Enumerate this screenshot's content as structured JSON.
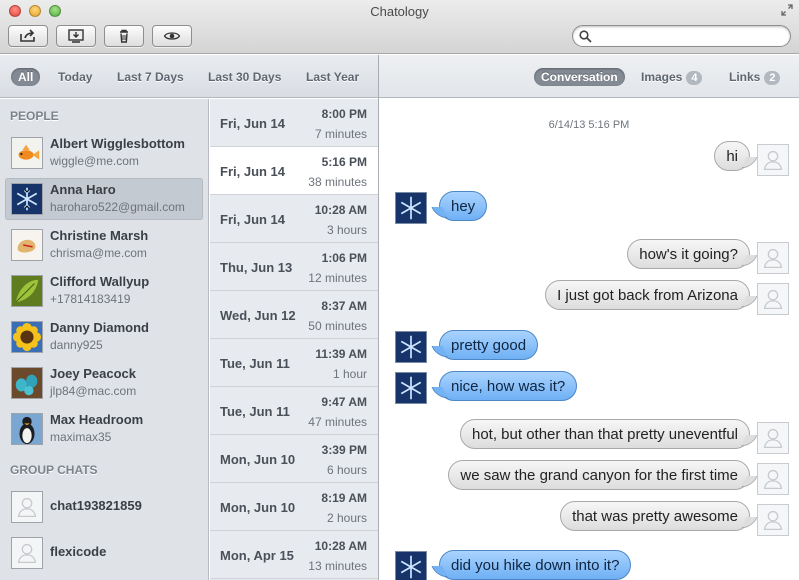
{
  "window": {
    "title": "Chatology"
  },
  "toolbar": {
    "buttons": [
      {
        "name": "share",
        "icon": "share-icon"
      },
      {
        "name": "export",
        "icon": "export-icon"
      },
      {
        "name": "delete",
        "icon": "trash-icon"
      },
      {
        "name": "preview",
        "icon": "eye-icon"
      }
    ],
    "search": {
      "value": "",
      "placeholder": "",
      "icon": "search-icon"
    }
  },
  "filters": [
    {
      "label": "All",
      "active": true
    },
    {
      "label": "Today"
    },
    {
      "label": "Last 7 Days"
    },
    {
      "label": "Last 30 Days"
    },
    {
      "label": "Last Year"
    }
  ],
  "view_tabs": [
    {
      "label": "Conversation",
      "active": true
    },
    {
      "label": "Images",
      "count": "4"
    },
    {
      "label": "Links",
      "count": "2"
    }
  ],
  "sidebar": {
    "people_header": "PEOPLE",
    "people": [
      {
        "name": "Albert Wigglesbottom",
        "sub": "wiggle@me.com",
        "avatar": "goldfish-avatar"
      },
      {
        "name": "Anna Haro",
        "sub": "haroharo522@gmail.com",
        "avatar": "snowflake-avatar",
        "selected": true
      },
      {
        "name": "Christine Marsh",
        "sub": "chrisma@me.com",
        "avatar": "fortune-cookie-avatar"
      },
      {
        "name": "Clifford Wallyup",
        "sub": "+17814183419",
        "avatar": "leaf-avatar"
      },
      {
        "name": "Danny Diamond",
        "sub": "danny925",
        "avatar": "sunflower-avatar"
      },
      {
        "name": "Joey Peacock",
        "sub": "jlp84@mac.com",
        "avatar": "eggs-avatar"
      },
      {
        "name": "Max Headroom",
        "sub": "maximax35",
        "avatar": "penguin-avatar"
      }
    ],
    "groups_header": "GROUP CHATS",
    "groups": [
      {
        "name": "chat193821859",
        "avatar": "person-silhouette-avatar"
      },
      {
        "name": "flexicode",
        "avatar": "person-silhouette-avatar"
      }
    ]
  },
  "conversations": [
    {
      "date": "Fri, Jun 14",
      "time": "8:00 PM",
      "duration": "7 minutes"
    },
    {
      "date": "Fri, Jun 14",
      "time": "5:16 PM",
      "duration": "38 minutes",
      "selected": true
    },
    {
      "date": "Fri, Jun 14",
      "time": "10:28 AM",
      "duration": "3 hours"
    },
    {
      "date": "Thu, Jun 13",
      "time": "1:06 PM",
      "duration": "12 minutes"
    },
    {
      "date": "Wed, Jun 12",
      "time": "8:37 AM",
      "duration": "50 minutes"
    },
    {
      "date": "Tue, Jun 11",
      "time": "11:39 AM",
      "duration": "1 hour"
    },
    {
      "date": "Tue, Jun 11",
      "time": "9:47 AM",
      "duration": "47 minutes"
    },
    {
      "date": "Mon, Jun 10",
      "time": "3:39 PM",
      "duration": "6 hours"
    },
    {
      "date": "Mon, Jun 10",
      "time": "8:19 AM",
      "duration": "2 hours"
    },
    {
      "date": "Mon, Apr 15",
      "time": "10:28 AM",
      "duration": "13 minutes"
    }
  ],
  "transcript": {
    "date": "6/14/13 5:16 PM",
    "messages": [
      {
        "from": "me",
        "text": "hi"
      },
      {
        "from": "them",
        "text": "hey"
      },
      {
        "from": "me",
        "text": "how's it going?"
      },
      {
        "from": "me",
        "text": "I just got back from Arizona"
      },
      {
        "from": "them",
        "text": "pretty good"
      },
      {
        "from": "them",
        "text": "nice, how was it?"
      },
      {
        "from": "me",
        "text": "hot, but other than that pretty uneventful"
      },
      {
        "from": "me",
        "text": "we saw the grand canyon for the first time"
      },
      {
        "from": "me",
        "text": "that was pretty awesome"
      },
      {
        "from": "them",
        "text": "did you hike down into it?"
      }
    ]
  },
  "colors": {
    "bubble_me": "#dddddd",
    "bubble_them": "#6fb0f4",
    "active_filter": "#838a94",
    "sidebar_bg": "#dfe3e8"
  }
}
